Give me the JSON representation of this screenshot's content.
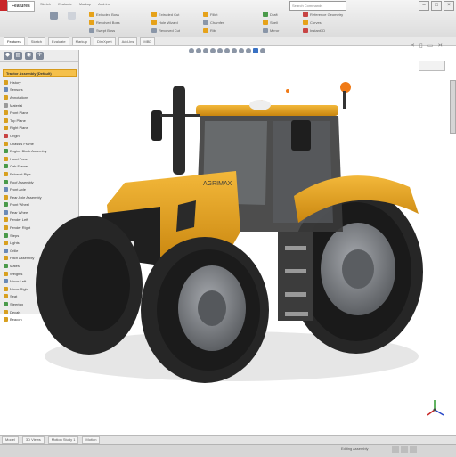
{
  "ribbon": {
    "file_tab": "Features",
    "menus": [
      "Sketch",
      "Evaluate",
      "Markup",
      "Add-ins"
    ],
    "search_placeholder": "Search Commands",
    "groups": [
      {
        "buttons": [
          "Extruded Boss",
          "Revolved Boss",
          "Swept Boss"
        ]
      },
      {
        "buttons": [
          "Extruded Cut",
          "Hole Wizard",
          "Revolved Cut"
        ]
      },
      {
        "buttons": [
          "Fillet",
          "Chamfer",
          "Rib"
        ]
      },
      {
        "buttons": [
          "Draft",
          "Shell",
          "Mirror"
        ]
      },
      {
        "buttons": [
          "Reference Geometry",
          "Curves",
          "Instant3D"
        ]
      }
    ]
  },
  "command_tabs": [
    "Features",
    "Sketch",
    "Evaluate",
    "Markup",
    "DimXpert",
    "Add-Ins",
    "MBD"
  ],
  "feature_tree": {
    "header": "Tractor Assembly (Default)",
    "nodes": [
      {
        "label": "History",
        "color": "#d8a020"
      },
      {
        "label": "Sensors",
        "color": "#6a8ab8"
      },
      {
        "label": "Annotations",
        "color": "#d8a020"
      },
      {
        "label": "Material",
        "color": "#9a9a9a"
      },
      {
        "label": "Front Plane",
        "color": "#d8a020"
      },
      {
        "label": "Top Plane",
        "color": "#d8a020"
      },
      {
        "label": "Right Plane",
        "color": "#d8a020"
      },
      {
        "label": "Origin",
        "color": "#c84444"
      },
      {
        "label": "Chassis Frame",
        "color": "#d8a020"
      },
      {
        "label": "Engine Block Assembly",
        "color": "#4a9a4a"
      },
      {
        "label": "Hood Panel",
        "color": "#d8a020"
      },
      {
        "label": "Cab Frame",
        "color": "#4a9a4a"
      },
      {
        "label": "Exhaust Pipe",
        "color": "#d8a020"
      },
      {
        "label": "Roof Assembly",
        "color": "#4a9a4a"
      },
      {
        "label": "Front Axle",
        "color": "#6a8ab8"
      },
      {
        "label": "Rear Axle Assembly",
        "color": "#d8a020"
      },
      {
        "label": "Front Wheel",
        "color": "#4a9a4a"
      },
      {
        "label": "Rear Wheel",
        "color": "#6a8ab8"
      },
      {
        "label": "Fender Left",
        "color": "#d8a020"
      },
      {
        "label": "Fender Right",
        "color": "#d8a020"
      },
      {
        "label": "Steps",
        "color": "#4a9a4a"
      },
      {
        "label": "Lights",
        "color": "#d8a020"
      },
      {
        "label": "Grille",
        "color": "#6a8ab8"
      },
      {
        "label": "Hitch Assembly",
        "color": "#d8a020"
      },
      {
        "label": "Mates",
        "color": "#4a9a4a"
      },
      {
        "label": "Weights",
        "color": "#d8a020"
      },
      {
        "label": "Mirror Left",
        "color": "#6a8ab8"
      },
      {
        "label": "Mirror Right",
        "color": "#d8a020"
      },
      {
        "label": "Seat",
        "color": "#d8a020"
      },
      {
        "label": "Steering",
        "color": "#4a9a4a"
      },
      {
        "label": "Decals",
        "color": "#d8a020"
      },
      {
        "label": "Beacon",
        "color": "#d8a020"
      }
    ]
  },
  "model": {
    "hood_decal": "AGRIMAX",
    "body_color": "#e8a21c",
    "tire_color": "#262626",
    "rim_color": "#7c7f84"
  },
  "status_tabs": [
    "Model",
    "3D Views",
    "Motion Study 1",
    "Motion"
  ],
  "status_text": "Editing Assembly",
  "colors": {
    "accent": "#f5c04a",
    "ribbon": "#dcdcdc",
    "tree_bg": "#ececec"
  }
}
